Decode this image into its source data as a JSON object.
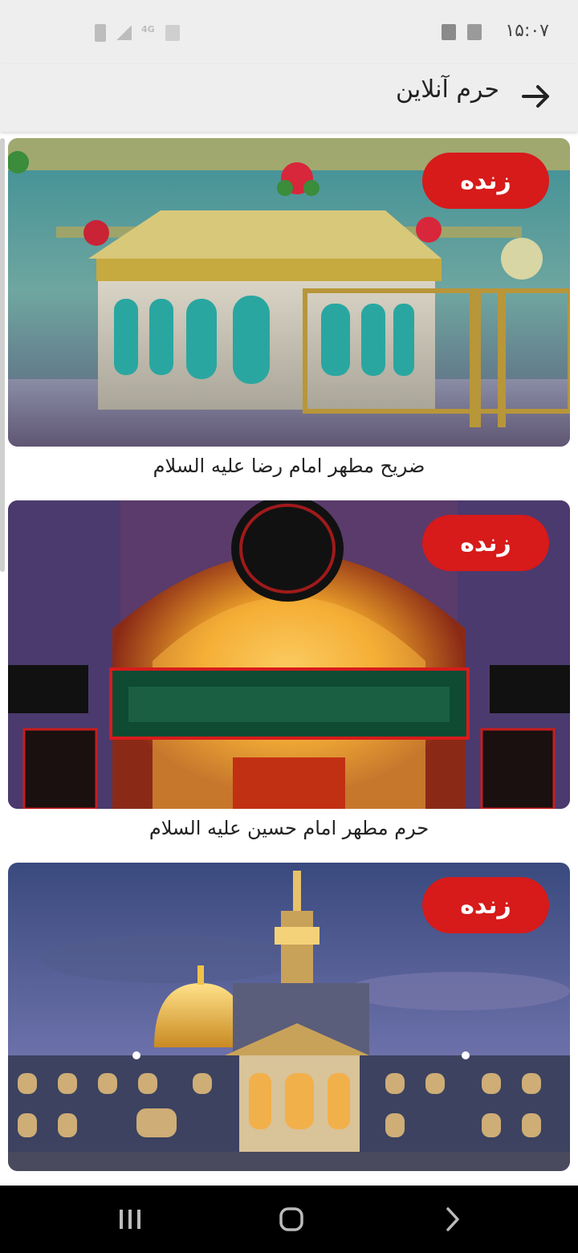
{
  "status_bar": {
    "time": "۱۵:۰۷",
    "icons": [
      "check-notification-icon",
      "image-notification-icon",
      "battery-icon",
      "signal-icon",
      "network-4g-icon",
      "sim-icon"
    ],
    "network_label": "4G"
  },
  "app_bar": {
    "title": "حرم آنلاین",
    "back_icon": "arrow-right-icon"
  },
  "cards": [
    {
      "badge": "زنده",
      "caption": "ضریح مطهر امام رضا علیه السلام"
    },
    {
      "badge": "زنده",
      "caption": "حرم مطهر امام حسین علیه السلام"
    },
    {
      "badge": "زنده",
      "caption": ""
    }
  ],
  "colors": {
    "badge": "#d71a1a",
    "app_bar_bg": "#eeeeee",
    "nav_bar_bg": "#000000"
  },
  "nav_bar": {
    "icons": [
      "recent-apps-icon",
      "home-icon",
      "back-icon"
    ]
  }
}
